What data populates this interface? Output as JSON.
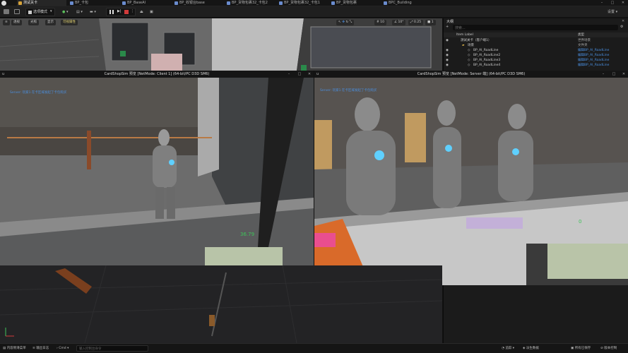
{
  "titlebar": {
    "tabs": [
      {
        "label": "测试关卡",
        "active": true
      },
      {
        "label": "BP_卡包",
        "active": false
      },
      {
        "label": "BP_BaseAI",
        "active": false
      },
      {
        "label": "BP_收银台base",
        "active": false
      },
      {
        "label": "BP_货物包裹32_卡包2",
        "active": false
      },
      {
        "label": "BP_货物包裹32_卡包1",
        "active": false
      },
      {
        "label": "BP_货物包裹",
        "active": false
      },
      {
        "label": "BPC_Building",
        "active": false
      }
    ]
  },
  "toolbar": {
    "mode_label": "选项模式",
    "settings_label": "设置"
  },
  "viewport_top": {
    "perspective_label": "透视",
    "lit_label": "光照",
    "show_label": "显示",
    "visibility_label": "可视属性",
    "grid_snap": "10",
    "rot_snap": "10°",
    "scale_snap": "0.25",
    "cam_speed": "1"
  },
  "outliner": {
    "title": "大纲",
    "search_placeholder": "搜索...",
    "col_label": "Item Label",
    "col_type": "类型",
    "rows": [
      {
        "label": "测试关卡（客户端1）",
        "type": "世界场景",
        "indent": 1
      },
      {
        "label": "场景",
        "type": "文件夹",
        "indent": 2
      },
      {
        "label": "BP_AI_RoadLine",
        "type": "编辑BP_AI_RoadLine",
        "indent": 3
      },
      {
        "label": "BP_AI_RoadLine2",
        "type": "编辑BP_AI_RoadLine",
        "indent": 3
      },
      {
        "label": "BP_AI_RoadLine3",
        "type": "编辑BP_AI_RoadLine",
        "indent": 3
      },
      {
        "label": "BP_AI_RoadLine4",
        "type": "编辑BP_AI_RoadLine",
        "indent": 3
      }
    ]
  },
  "client_window": {
    "title": "CardShopSim 预览 [NetMode: Client 1]  (64-bit/PC D3D SM6)",
    "hud_line": "Server: 玩家1 在卡区域发起了卡包购买",
    "hud_number": "36.79"
  },
  "server_window": {
    "title": "CardShopSim 预览 [NetMode: Server 端]  (64-bit/PC D3D SM6)",
    "hud_line": "Server: 玩家1 在卡区域发起了卡包购买",
    "hud_number": "0"
  },
  "statusbar": {
    "content_drawer": "内容侧滑菜单",
    "output_log": "输出日志",
    "cmd_label": "Cmd",
    "console_placeholder": "输入控制台命令",
    "trace": "追踪",
    "derived_data": "派生数据",
    "all_saved": "所有已保存",
    "version_control": "版本控制"
  },
  "colors": {
    "accent_blue": "#4a8fe0",
    "hud_green": "#3fc35a",
    "stop_red": "#d03a3a"
  }
}
